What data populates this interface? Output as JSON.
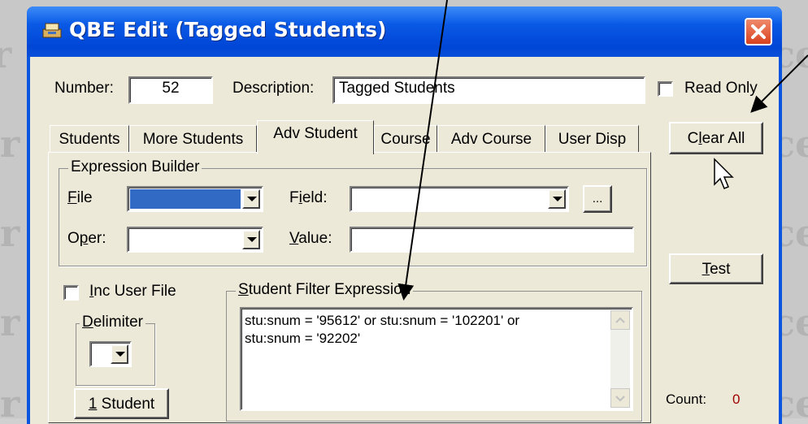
{
  "window": {
    "title": "QBE Edit  (Tagged Students)"
  },
  "header": {
    "number_label": "Number:",
    "number_value": "52",
    "description_label": "Description:",
    "description_value": "Tagged Students",
    "readonly_label": "Read Only"
  },
  "tabs": [
    {
      "label": "Students",
      "active": false
    },
    {
      "label": "More Students",
      "active": false
    },
    {
      "label": "Adv Student",
      "active": true
    },
    {
      "label": "Course",
      "active": false
    },
    {
      "label": "Adv Course",
      "active": false
    },
    {
      "label": "User Disp",
      "active": false
    }
  ],
  "expression_builder": {
    "legend": "Expression Builder",
    "file_label": "File",
    "field_label": "Field:",
    "oper_label": "Oper:",
    "value_label": "Value:",
    "ellipsis_label": "..."
  },
  "inc_user_file_label": "Inc User File",
  "delimiter_legend": "Delimiter",
  "one_student_label": "1 Student",
  "filter": {
    "legend": "Student Filter Expression",
    "lines": [
      "stu:snum = '95612' or stu:snum = '102201' or",
      "stu:snum = '92202'"
    ]
  },
  "buttons": {
    "clear_all": "Clear All",
    "test": "Test"
  },
  "count_label": "Count:",
  "count_value": "0",
  "colors": {
    "titlebar": "#0a55e0",
    "client": "#ece9d8",
    "count": "#a00000",
    "selection": "#316ac5"
  }
}
